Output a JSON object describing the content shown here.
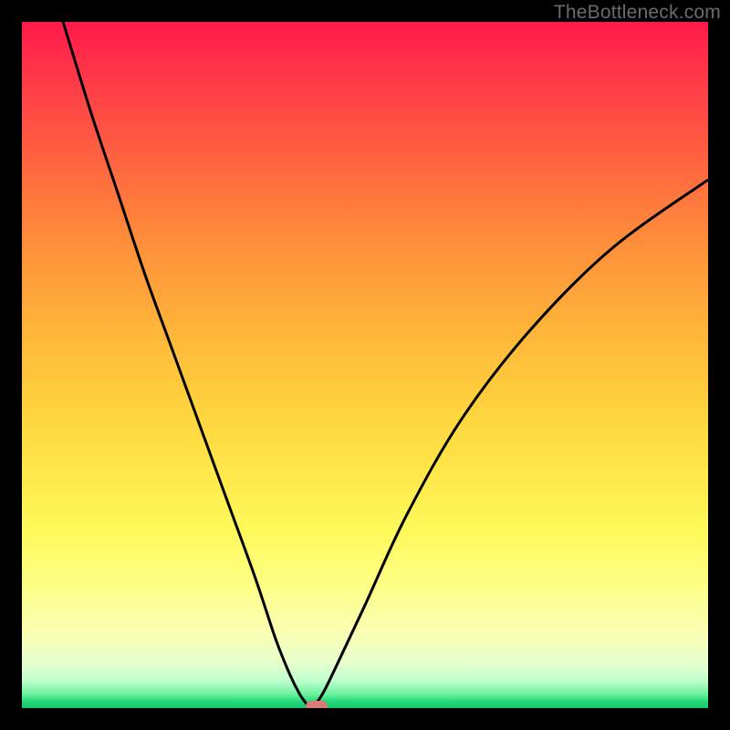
{
  "watermark": "TheBottleneck.com",
  "chart_data": {
    "type": "line",
    "title": "",
    "xlabel": "",
    "ylabel": "",
    "xlim": [
      0,
      100
    ],
    "ylim": [
      0,
      100
    ],
    "series": [
      {
        "name": "bottleneck-curve",
        "x": [
          6,
          10,
          14,
          18,
          22,
          26,
          30,
          34,
          37,
          39,
          40.5,
          41.5,
          42,
          42.8,
          44,
          46,
          50,
          56,
          64,
          74,
          86,
          100
        ],
        "y": [
          100,
          87,
          75,
          63,
          52,
          41,
          30,
          19,
          10,
          5,
          2,
          0.6,
          0,
          0.6,
          2.4,
          6.5,
          15,
          28,
          42,
          55,
          67,
          77
        ]
      }
    ],
    "marker": {
      "x": 43,
      "y": 0.2,
      "label": "optimal-point"
    },
    "background_gradient": {
      "type": "vertical",
      "stops": [
        {
          "at": 0,
          "color": "#ff1a4b"
        },
        {
          "at": 50,
          "color": "#ffd23d"
        },
        {
          "at": 88,
          "color": "#fdff84"
        },
        {
          "at": 100,
          "color": "#14c76c"
        }
      ]
    }
  }
}
